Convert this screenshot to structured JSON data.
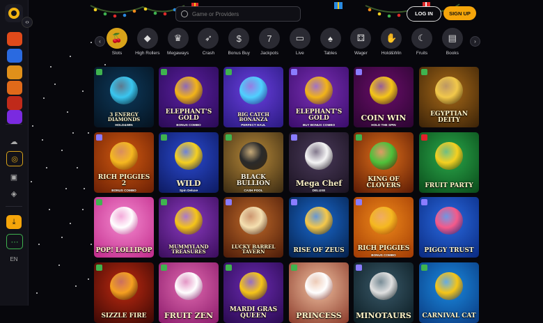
{
  "header": {
    "search_placeholder": "Game or Providers",
    "login_label": "LOG IN",
    "signup_label": "SIGN UP"
  },
  "categories": [
    {
      "label": "Slots",
      "icon": "slots-icon",
      "glyph": "🍒"
    },
    {
      "label": "High Rollers",
      "icon": "high-rollers-icon",
      "glyph": "◆"
    },
    {
      "label": "Megaways",
      "icon": "megaways-icon",
      "glyph": "♛"
    },
    {
      "label": "Crash",
      "icon": "crash-icon",
      "glyph": "➶"
    },
    {
      "label": "Bonus Buy",
      "icon": "bonus-buy-icon",
      "glyph": "$"
    },
    {
      "label": "Jackpots",
      "icon": "jackpots-icon",
      "glyph": "7"
    },
    {
      "label": "Live",
      "icon": "live-icon",
      "glyph": "▭"
    },
    {
      "label": "Tables",
      "icon": "tables-icon",
      "glyph": "♠"
    },
    {
      "label": "Wager",
      "icon": "wager-icon",
      "glyph": "⚃"
    },
    {
      "label": "Hold&Win",
      "icon": "hold-win-icon",
      "glyph": "✋"
    },
    {
      "label": "Fruits",
      "icon": "fruits-icon",
      "glyph": "☾"
    },
    {
      "label": "Books",
      "icon": "books-icon",
      "glyph": "▤"
    }
  ],
  "games": [
    {
      "title": "3 ENERGY DIAMONDS",
      "sub": "HOLD&WIN",
      "bg": [
        "#0d3a5c",
        "#05121f"
      ],
      "accent": "#39c6f0",
      "badge": "#3fb34f"
    },
    {
      "title": "ELEPHANT'S GOLD",
      "sub": "BONUS COMBO",
      "bg": [
        "#5a1fa0",
        "#2a0b55"
      ],
      "accent": "#f2b418",
      "badge": "#3fb34f"
    },
    {
      "title": "BIG CATCH BONANZA",
      "sub": "PERFECT HAUL",
      "bg": [
        "#6a3fe0",
        "#2a1a80"
      ],
      "accent": "#4fd0ff",
      "badge": "#3fb34f"
    },
    {
      "title": "ELEPHANT'S GOLD",
      "sub": "BUY BONUS COMBO",
      "bg": [
        "#7a2fb5",
        "#3a0d6a"
      ],
      "accent": "#f2b418",
      "badge": "#8a7cff"
    },
    {
      "title": "COIN WIN",
      "sub": "HOLD THE SPIN",
      "bg": [
        "#6a0d6a",
        "#2a0530"
      ],
      "accent": "#f5c518",
      "badge": "#8a7cff"
    },
    {
      "title": "EGYPTIAN DEITY",
      "sub": "",
      "bg": [
        "#a86a18",
        "#3a2208"
      ],
      "accent": "#f2c84a",
      "badge": "#3fb34f"
    },
    {
      "title": "RICH PIGGIES 2",
      "sub": "BONUS COMBO",
      "bg": [
        "#d15a10",
        "#6a1f05"
      ],
      "accent": "#f5b820",
      "badge": "#8a7cff"
    },
    {
      "title": "WILD",
      "sub": "Spin Deluxe",
      "bg": [
        "#2a4ad0",
        "#0d1a60"
      ],
      "accent": "#f5d020",
      "badge": "#3fb34f"
    },
    {
      "title": "BLACK BULLION",
      "sub": "CASH POOL",
      "bg": [
        "#b88a3a",
        "#3a2a12"
      ],
      "accent": "#2a2a2a",
      "badge": "#3fb34f"
    },
    {
      "title": "Mega Chef",
      "sub": "DELUXE",
      "bg": [
        "#4a3a5a",
        "#1a1220"
      ],
      "accent": "#f5f5f5",
      "badge": "#8a7cff"
    },
    {
      "title": "KING OF CLOVERS",
      "sub": "",
      "bg": [
        "#e0701a",
        "#5a1a05"
      ],
      "accent": "#4ec13a",
      "badge": "#3fb34f"
    },
    {
      "title": "FRUIT PARTY",
      "sub": "",
      "bg": [
        "#2aa84a",
        "#0a4a1a"
      ],
      "accent": "#f5d020",
      "badge": "#e0202a"
    },
    {
      "title": "POP! LOLLIPOP",
      "sub": "",
      "bg": [
        "#f58ad0",
        "#c02a8a"
      ],
      "accent": "#ffffff",
      "badge": "#3fb34f"
    },
    {
      "title": "MUMMYLAND TREASURES",
      "sub": "",
      "bg": [
        "#8a3ac0",
        "#3a0d5a"
      ],
      "accent": "#f5c518",
      "badge": "#3fb34f"
    },
    {
      "title": "LUCKY BARREL TAVERN",
      "sub": "",
      "bg": [
        "#c06a2a",
        "#4a1a08"
      ],
      "accent": "#f5e0b0",
      "badge": "#8a7cff"
    },
    {
      "title": "RISE OF ZEUS",
      "sub": "",
      "bg": [
        "#1a6ad0",
        "#05204a"
      ],
      "accent": "#f5c84a",
      "badge": "#8a7cff"
    },
    {
      "title": "RICH PIGGIES",
      "sub": "BONUS COMBO",
      "bg": [
        "#f08a1a",
        "#a03a05"
      ],
      "accent": "#f5b820",
      "badge": "#8a7cff"
    },
    {
      "title": "PIGGY TRUST",
      "sub": "",
      "bg": [
        "#2a6ae0",
        "#0a2a80"
      ],
      "accent": "#f55a8a",
      "badge": "#8a7cff"
    },
    {
      "title": "SIZZLE FIRE",
      "sub": "",
      "bg": [
        "#c02a10",
        "#3a0805"
      ],
      "accent": "#f5a020",
      "badge": "#3fb34f"
    },
    {
      "title": "FRUIT ZEN",
      "sub": "",
      "bg": [
        "#e06ab0",
        "#8a1a6a"
      ],
      "accent": "#ffffff",
      "badge": "#3fb34f"
    },
    {
      "title": "MARDI GRAS QUEEN",
      "sub": "",
      "bg": [
        "#6a2ab0",
        "#2a0a50"
      ],
      "accent": "#f5c518",
      "badge": "#3fb34f"
    },
    {
      "title": "PRINCESS",
      "sub": "",
      "bg": [
        "#f0c0a0",
        "#8a3a2a"
      ],
      "accent": "#ffffff",
      "badge": "#3fb34f"
    },
    {
      "title": "MINOTAURS",
      "sub": "",
      "bg": [
        "#3a5a6a",
        "#0a1a20"
      ],
      "accent": "#e0e0e0",
      "badge": "#8a7cff"
    },
    {
      "title": "CARNIVAL CAT",
      "sub": "",
      "bg": [
        "#1a8ae0",
        "#0a3a80"
      ],
      "accent": "#f5c518",
      "badge": "#3fb34f"
    }
  ],
  "sidebar": {
    "items": [
      {
        "icon": "clock-icon",
        "color": "#e04a1a"
      },
      {
        "icon": "spin-icon",
        "color": "#2a6ae0"
      },
      {
        "icon": "crown-icon",
        "color": "#e0901a"
      },
      {
        "icon": "gift-icon",
        "color": "#e06a1a"
      },
      {
        "icon": "dice-icon",
        "color": "#c02a1a"
      },
      {
        "icon": "trophy-icon",
        "color": "#7a2ae0"
      }
    ],
    "language": "EN"
  }
}
